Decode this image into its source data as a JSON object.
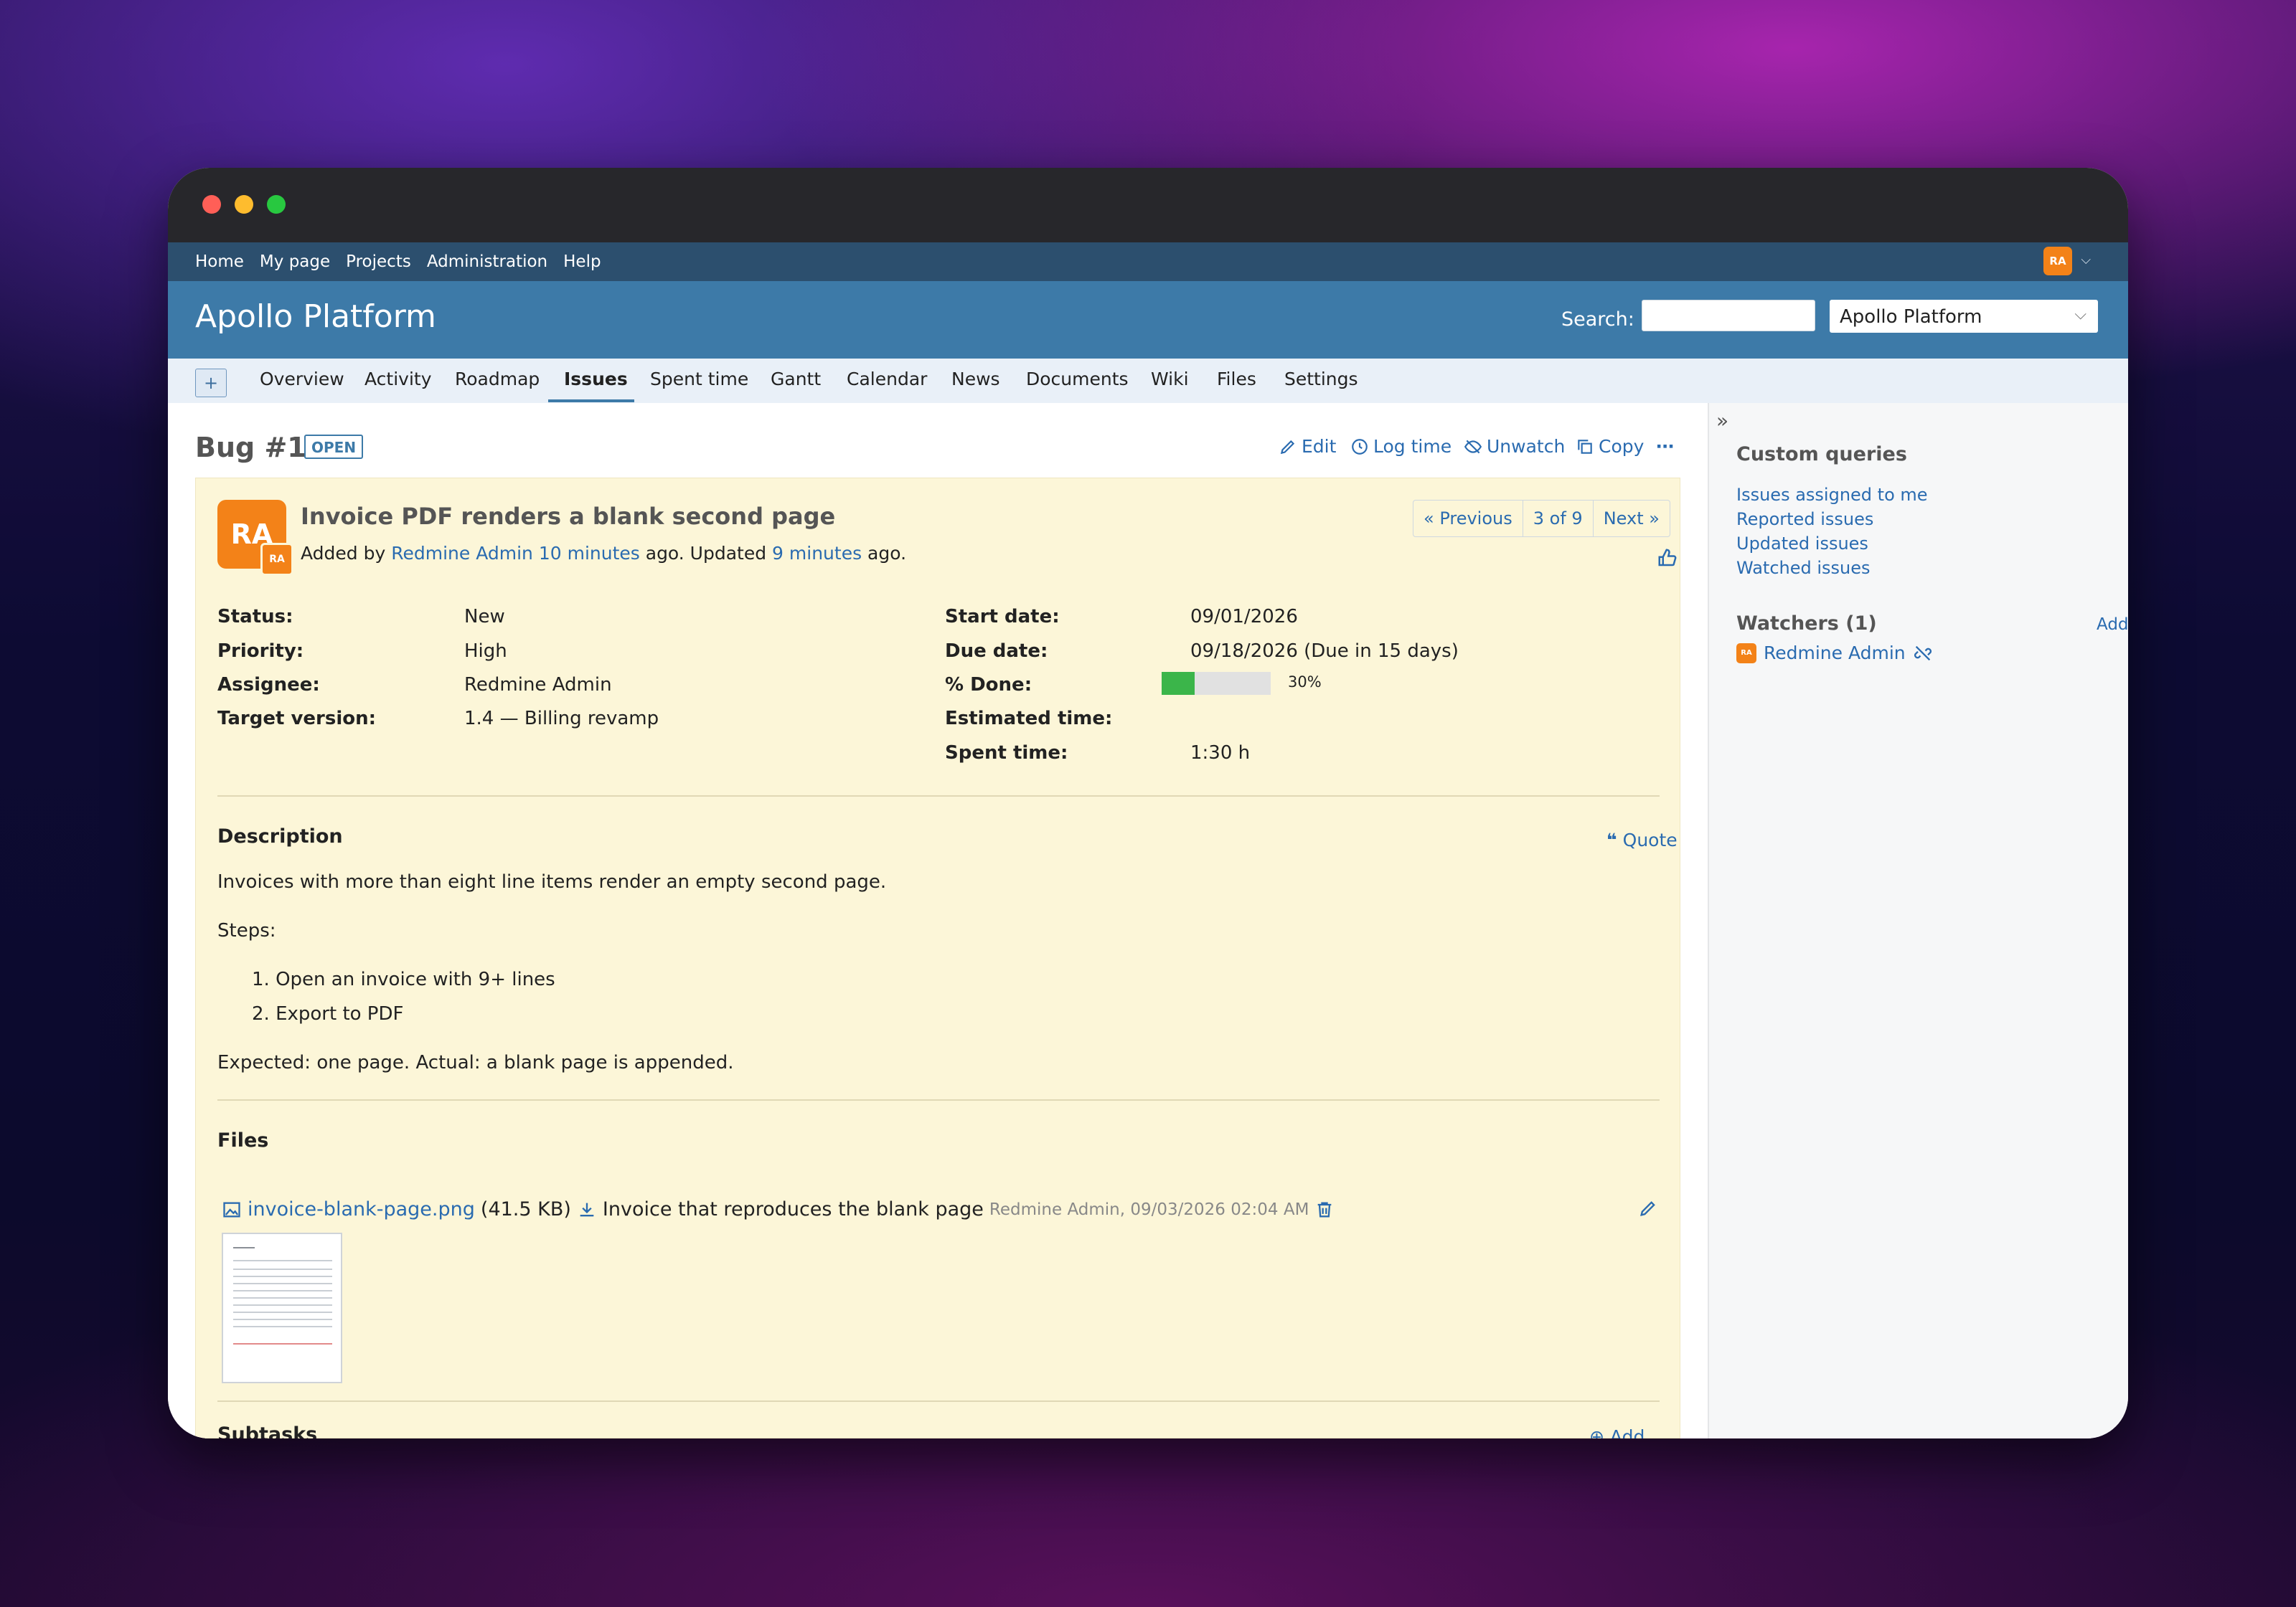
{
  "topmenu": {
    "items": [
      "Home",
      "My page",
      "Projects",
      "Administration",
      "Help"
    ],
    "avatar": "RA"
  },
  "header": {
    "title": "Apollo Platform",
    "search_label": "Search:",
    "search_value": "",
    "project_select": "Apollo Platform"
  },
  "tabs": {
    "new": "+",
    "items": [
      "Overview",
      "Activity",
      "Roadmap",
      "Issues",
      "Spent time",
      "Gantt",
      "Calendar",
      "News",
      "Documents",
      "Wiki",
      "Files",
      "Settings"
    ],
    "active": "Issues"
  },
  "issue": {
    "heading": "Bug #1",
    "status_badge": "OPEN",
    "actions": {
      "edit": "Edit",
      "log_time": "Log time",
      "unwatch": "Unwatch",
      "copy": "Copy",
      "more": "⋯"
    },
    "avatar": "RA",
    "subject": "Invoice PDF renders a blank second page",
    "added_by_prefix": "Added by ",
    "author": "Redmine Admin",
    "created_ago": "10 minutes",
    "updated_mid": " ago. Updated ",
    "updated_ago": "9 minutes",
    "ago_suffix": " ago.",
    "pager": {
      "previous": "« Previous",
      "position": "3 of 9",
      "next": "Next »"
    },
    "attributes_left": [
      {
        "label": "Status:",
        "value": "New"
      },
      {
        "label": "Priority:",
        "value": "High"
      },
      {
        "label": "Assignee:",
        "value": "Redmine Admin"
      },
      {
        "label": "Target version:",
        "value": "1.4 — Billing revamp"
      }
    ],
    "attributes_right": [
      {
        "label": "Start date:",
        "value": "09/01/2026"
      },
      {
        "label": "Due date:",
        "value": "09/18/2026 (Due in 15 days)"
      },
      {
        "label": "% Done:",
        "value": "30%"
      },
      {
        "label": "Estimated time:",
        "value": ""
      },
      {
        "label": "Spent time:",
        "value": "1:30 h"
      }
    ],
    "done_fraction": 0.3,
    "description": {
      "title": "Description",
      "quote": "Quote",
      "p1": "Invoices with more than eight line items render an empty second page.",
      "p2": "Steps:",
      "steps": [
        "1. Open an invoice with 9+ lines",
        "2. Export to PDF"
      ],
      "p3": "Expected: one page. Actual: a blank page is appended."
    },
    "files": {
      "title": "Files",
      "name": "invoice-blank-page.png",
      "size": "(41.5 KB)",
      "description": "Invoice that reproduces the blank page",
      "meta": "Redmine Admin, 09/03/2026 02:04 AM"
    },
    "subtasks": {
      "title": "Subtasks",
      "add": "Add"
    }
  },
  "sidebar": {
    "custom_queries_title": "Custom queries",
    "queries": [
      "Issues assigned to me",
      "Reported issues",
      "Updated issues",
      "Watched issues"
    ],
    "watchers_title": "Watchers (1)",
    "watchers_add": "Add",
    "watcher_name": "Redmine Admin",
    "watcher_avatar": "RA"
  },
  "colors": {
    "accent": "#3d7aa8",
    "link": "#2a6bb0",
    "panel": "#fcf6d8",
    "avatar": "#f38218",
    "progress": "#3bb54a"
  }
}
